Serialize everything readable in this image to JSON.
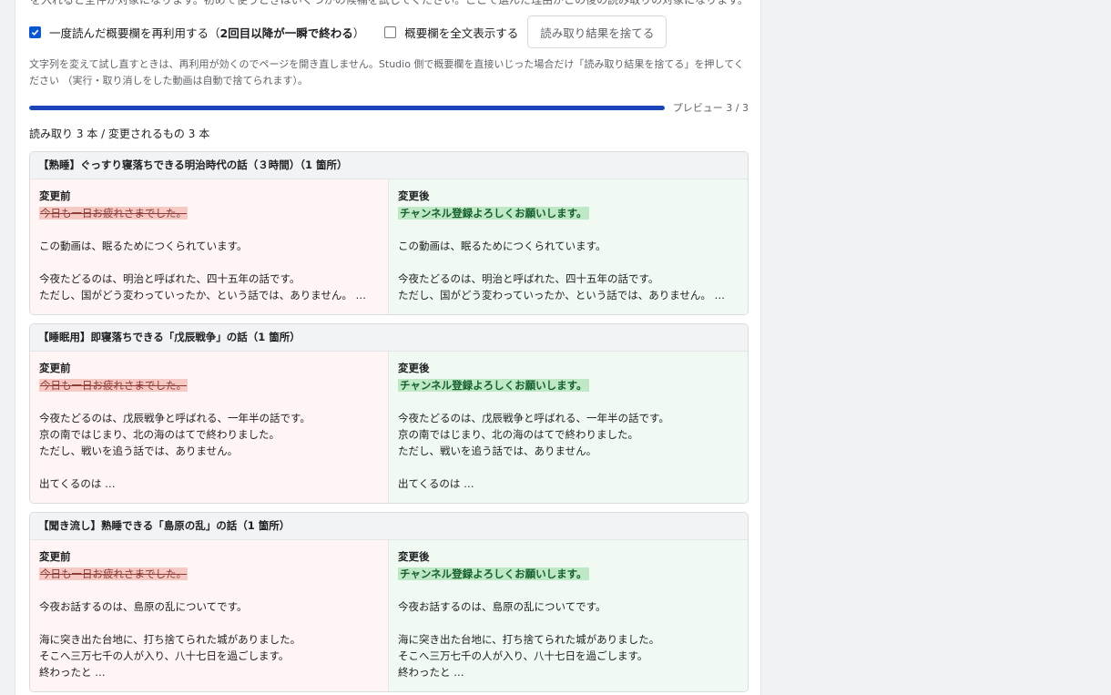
{
  "header": {
    "cut_text": "を入れると全件が対象になります。初めて使うときはいくつかの候補を試してください。ここで選んだ理由がこの後の読み取りの対象になります。"
  },
  "options": {
    "reuse_checked": true,
    "reuse_label": "一度読んだ概要欄を再利用する（",
    "reuse_strong": "2回目以降が一瞬で終わる",
    "reuse_suffix": "）",
    "fulltext_checked": false,
    "fulltext_label": "概要欄を全文表示する",
    "discard_button": "読み取り結果を捨てる"
  },
  "help_text": "文字列を変えて試し直すときは、再利用が効くのでページを開き直しません。Studio 側で概要欄を直接いじった場合だけ「読み取り結果を捨てる」を押してください （実行・取り消しをした動画は自動で捨てられます）。",
  "progress": {
    "fraction": 1.0,
    "label": "プレビュー 3 / 3"
  },
  "summary": "読み取り 3 本 / 変更されるもの 3 本",
  "colors": {
    "accent": "#0b57d0",
    "progress": "#1a45b8",
    "before_bg": "#fef5f4",
    "after_bg": "#f1faf2",
    "deleted": "#f6c9c5",
    "inserted": "#bfe8c6"
  },
  "cards": [
    {
      "title": "【熟睡】ぐっすり寝落ちできる明治時代の話（３時間）（1 箇所）",
      "before_label": "変更前",
      "after_label": "変更後",
      "removed": "今日も一日お疲れさまでした。",
      "added": "チャンネル登録よろしくお願いします。",
      "lines": [
        "",
        "この動画は、眠るためにつくられています。",
        "",
        "今夜たどるのは、明治と呼ばれた、四十五年の話です。",
        "ただし、国がどう変わっていったか、という話では、ありません。 …"
      ]
    },
    {
      "title": "【睡眠用】即寝落ちできる「戊辰戦争」の話（1 箇所）",
      "before_label": "変更前",
      "after_label": "変更後",
      "removed": "今日も一日お疲れさまでした。",
      "added": "チャンネル登録よろしくお願いします。",
      "lines": [
        "",
        "今夜たどるのは、戊辰戦争と呼ばれる、一年半の話です。",
        "京の南ではじまり、北の海のはてで終わりました。",
        "ただし、戦いを追う話では、ありません。",
        "",
        "出てくるのは …"
      ]
    },
    {
      "title": "【聞き流し】熟睡できる「島原の乱」の話（1 箇所）",
      "before_label": "変更前",
      "after_label": "変更後",
      "removed": "今日も一日お疲れさまでした。",
      "added": "チャンネル登録よろしくお願いします。",
      "lines": [
        "",
        "今夜お話するのは、島原の乱についてです。",
        "",
        "海に突き出た台地に、打ち捨てられた城がありました。",
        "そこへ三万七千の人が入り、八十七日を過ごします。",
        "終わったと …"
      ]
    }
  ]
}
